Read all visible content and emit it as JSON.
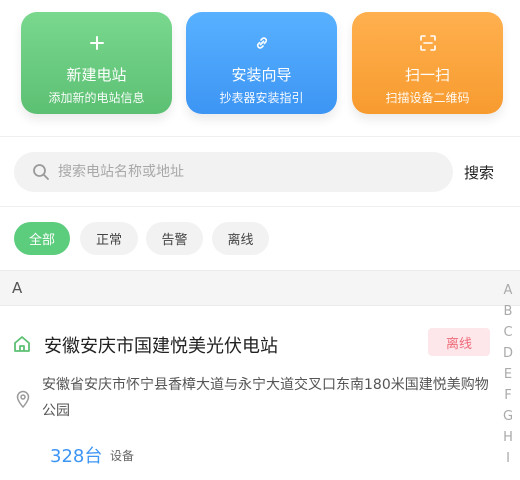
{
  "actions": [
    {
      "title": "新建电站",
      "subtitle": "添加新的电站信息",
      "icon": "plus-icon"
    },
    {
      "title": "安装向导",
      "subtitle": "抄表器安装指引",
      "icon": "link-icon"
    },
    {
      "title": "扫一扫",
      "subtitle": "扫描设备二维码",
      "icon": "scan-icon"
    }
  ],
  "search": {
    "placeholder": "搜索电站名称或地址",
    "button": "搜索"
  },
  "filters": [
    "全部",
    "正常",
    "告警",
    "离线"
  ],
  "active_filter": "全部",
  "section_letter": "A",
  "alphabet": [
    "A",
    "B",
    "C",
    "D",
    "E",
    "F",
    "G",
    "H",
    "I"
  ],
  "station": {
    "name": "安徽安庆市国建悦美光伏电站",
    "status": "离线",
    "address": "安徽省安庆市怀宁县香樟大道与永宁大道交叉口东南180米国建悦美购物公园",
    "device_count": "328台",
    "device_unit": "设备"
  },
  "colors": {
    "green": "#5cc073",
    "blue": "#3d95f4",
    "orange": "#f79b2f",
    "offline": "#ef6b7a"
  }
}
